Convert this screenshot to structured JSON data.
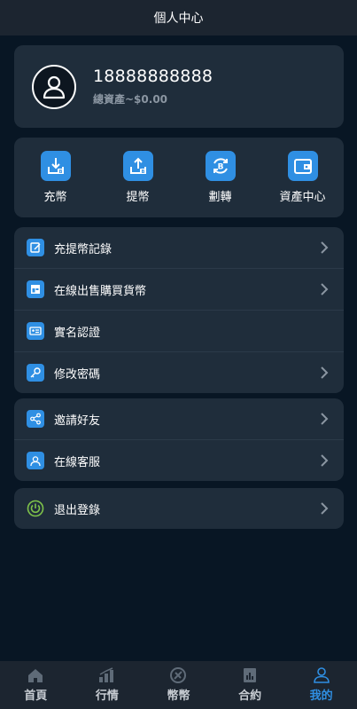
{
  "header": {
    "title": "個人中心"
  },
  "profile": {
    "phone": "18888888888",
    "assets": "總資產~$0.00"
  },
  "actions": [
    {
      "label": "充幣",
      "icon": "deposit-icon"
    },
    {
      "label": "提幣",
      "icon": "withdraw-icon"
    },
    {
      "label": "劃轉",
      "icon": "transfer-icon"
    },
    {
      "label": "資產中心",
      "icon": "wallet-icon"
    }
  ],
  "menu1": [
    {
      "label": "充提幣記錄",
      "icon": "records-icon",
      "chevron": true
    },
    {
      "label": "在線出售購買貨幣",
      "icon": "otc-icon",
      "chevron": true
    },
    {
      "label": "實名認證",
      "icon": "id-card-icon",
      "chevron": false
    },
    {
      "label": "修改密碼",
      "icon": "key-icon",
      "chevron": true
    }
  ],
  "menu2": [
    {
      "label": "邀請好友",
      "icon": "share-icon",
      "chevron": true
    },
    {
      "label": "在線客服",
      "icon": "support-icon",
      "chevron": true
    }
  ],
  "menu3": [
    {
      "label": "退出登錄",
      "icon": "power-icon",
      "chevron": true
    }
  ],
  "tabs": [
    {
      "label": "首頁",
      "icon": "home-icon"
    },
    {
      "label": "行情",
      "icon": "market-icon"
    },
    {
      "label": "幣幣",
      "icon": "coin-icon"
    },
    {
      "label": "合約",
      "icon": "contract-icon"
    },
    {
      "label": "我的",
      "icon": "user-icon",
      "active": true
    }
  ],
  "colors": {
    "accent": "#2f8fe3",
    "background": "#081624",
    "card": "#1f2d3b",
    "power": "#7ec24a"
  }
}
